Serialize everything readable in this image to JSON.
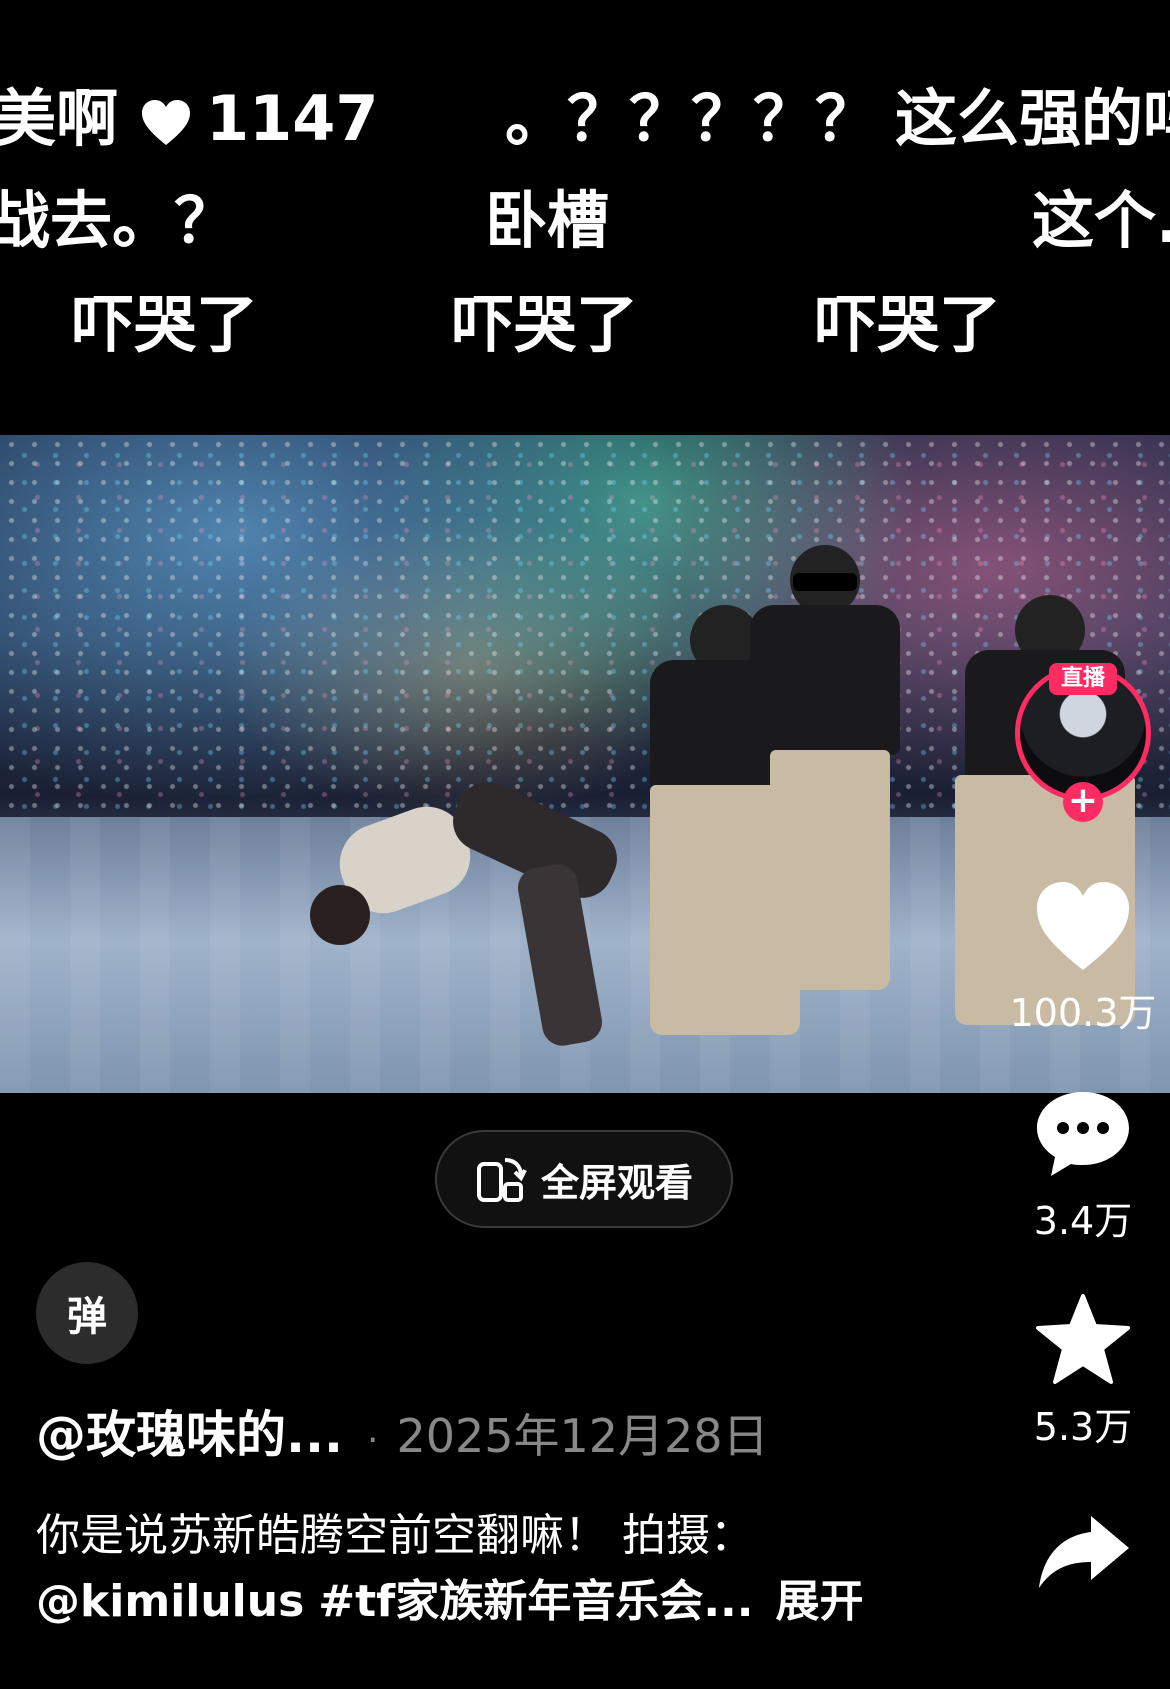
{
  "danmaku": [
    {
      "row": 1,
      "text": "美啊",
      "likes": "1147"
    },
    {
      "row": 1,
      "text": "。？？？？？"
    },
    {
      "row": 1,
      "text": "这么强的吗"
    },
    {
      "row": 2,
      "text": "战去。？"
    },
    {
      "row": 2,
      "text": "卧槽"
    },
    {
      "row": 2,
      "text": "这个..."
    },
    {
      "row": 3,
      "text": "吓哭了"
    },
    {
      "row": 3,
      "text": "吓哭了"
    },
    {
      "row": 3,
      "text": "吓哭了"
    }
  ],
  "video": {
    "fullscreen_label": "全屏观看"
  },
  "author": {
    "live_badge": "直播",
    "follow_icon": "plus-icon",
    "name": "@玫瑰味的...",
    "date": "2025年12月28日"
  },
  "actions": {
    "like_count": "100.3万",
    "comment_count": "3.4万",
    "favorite_count": "5.3万",
    "share_icon": "share-arrow-icon"
  },
  "danmu_toggle_label": "弹",
  "caption": {
    "text": "你是说苏新皓腾空前空翻嘛！ 拍摄：",
    "mention": "@kimilulus",
    "hashtag": "#tf家族新年音乐会...",
    "expand_label": "展开"
  },
  "colors": {
    "accent": "#ff2b63",
    "muted_text": "#888888",
    "background": "#000000"
  }
}
